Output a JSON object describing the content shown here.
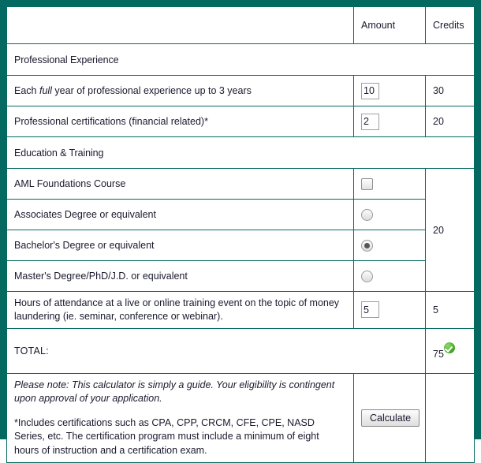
{
  "theme": {
    "frame_color": "#046a61",
    "grid_color": "#046a61",
    "text_color": "#1a1a2e",
    "badge_color": "#3fa31e"
  },
  "table": {
    "headers": {
      "label": "",
      "amount": "Amount",
      "credits": "Credits"
    },
    "sections": [
      {
        "title": "Professional Experience",
        "rows": [
          {
            "label_before": "Each ",
            "label_italic": "full",
            "label_after": " year of professional experience up to 3 years",
            "control": "text",
            "amount": "10",
            "credits": "30"
          },
          {
            "label_before": "Professional certifications (financial related)*",
            "label_italic": "",
            "label_after": "",
            "control": "text",
            "amount": "2",
            "credits": "20"
          }
        ]
      },
      {
        "title": "Education & Training",
        "rows": [
          {
            "label_before": "AML Foundations Course",
            "label_italic": "",
            "label_after": "",
            "control": "checkbox",
            "checked": false,
            "amount": "",
            "credits": "20"
          },
          {
            "label_before": "Associates Degree or equivalent",
            "label_italic": "",
            "label_after": "",
            "control": "radio",
            "checked": false,
            "amount": "",
            "credits": ""
          },
          {
            "label_before": "Bachelor's Degree or equivalent",
            "label_italic": "",
            "label_after": "",
            "control": "radio",
            "checked": true,
            "amount": "",
            "credits": ""
          },
          {
            "label_before": "Master's Degree/PhD/J.D. or equivalent",
            "label_italic": "",
            "label_after": "",
            "control": "radio",
            "checked": false,
            "amount": "",
            "credits": ""
          },
          {
            "label_before": "Hours of attendance at a live or online training event on the topic of money laundering (ie. seminar, conference or webinar).",
            "label_italic": "",
            "label_after": "",
            "control": "text",
            "amount": "5",
            "credits": "5"
          }
        ]
      }
    ],
    "total": {
      "label": "TOTAL:",
      "value": "75",
      "badge": "check-circle-icon"
    }
  },
  "footer": {
    "note_1": "Please note:  This calculator is simply a guide. Your eligibility is contingent upon approval of your application.",
    "note_2": "*Includes certifications such as CPA, CPP, CRCM, CFE, CPE, NASD Series, etc. The certification program must include a minimum of eight hours of instruction and a certification exam.",
    "calculate_label": "Calculate"
  }
}
